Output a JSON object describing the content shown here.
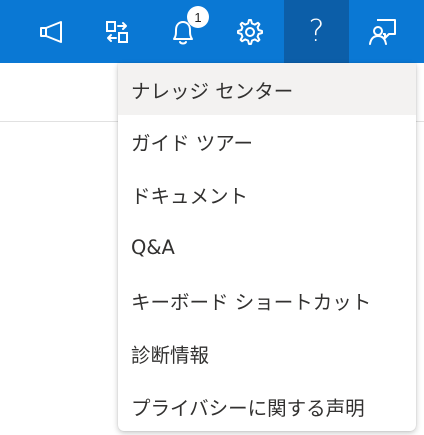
{
  "topbar": {
    "background": "#0a78d4",
    "active_background": "#0c5ea8",
    "icons": [
      {
        "name": "megaphone-icon"
      },
      {
        "name": "transfer-icon"
      },
      {
        "name": "bell-icon"
      },
      {
        "name": "gear-icon"
      },
      {
        "name": "help-icon"
      },
      {
        "name": "feedback-icon"
      }
    ],
    "notification_count": "1",
    "help_label": "?"
  },
  "help_menu": {
    "items": [
      {
        "label": "ナレッジ センター",
        "hovered": true
      },
      {
        "label": "ガイド ツアー"
      },
      {
        "label": "ドキュメント"
      },
      {
        "label": "Q&A"
      },
      {
        "label": "キーボード ショートカット"
      },
      {
        "label": "診断情報"
      },
      {
        "label": "プライバシーに関する声明"
      }
    ]
  }
}
